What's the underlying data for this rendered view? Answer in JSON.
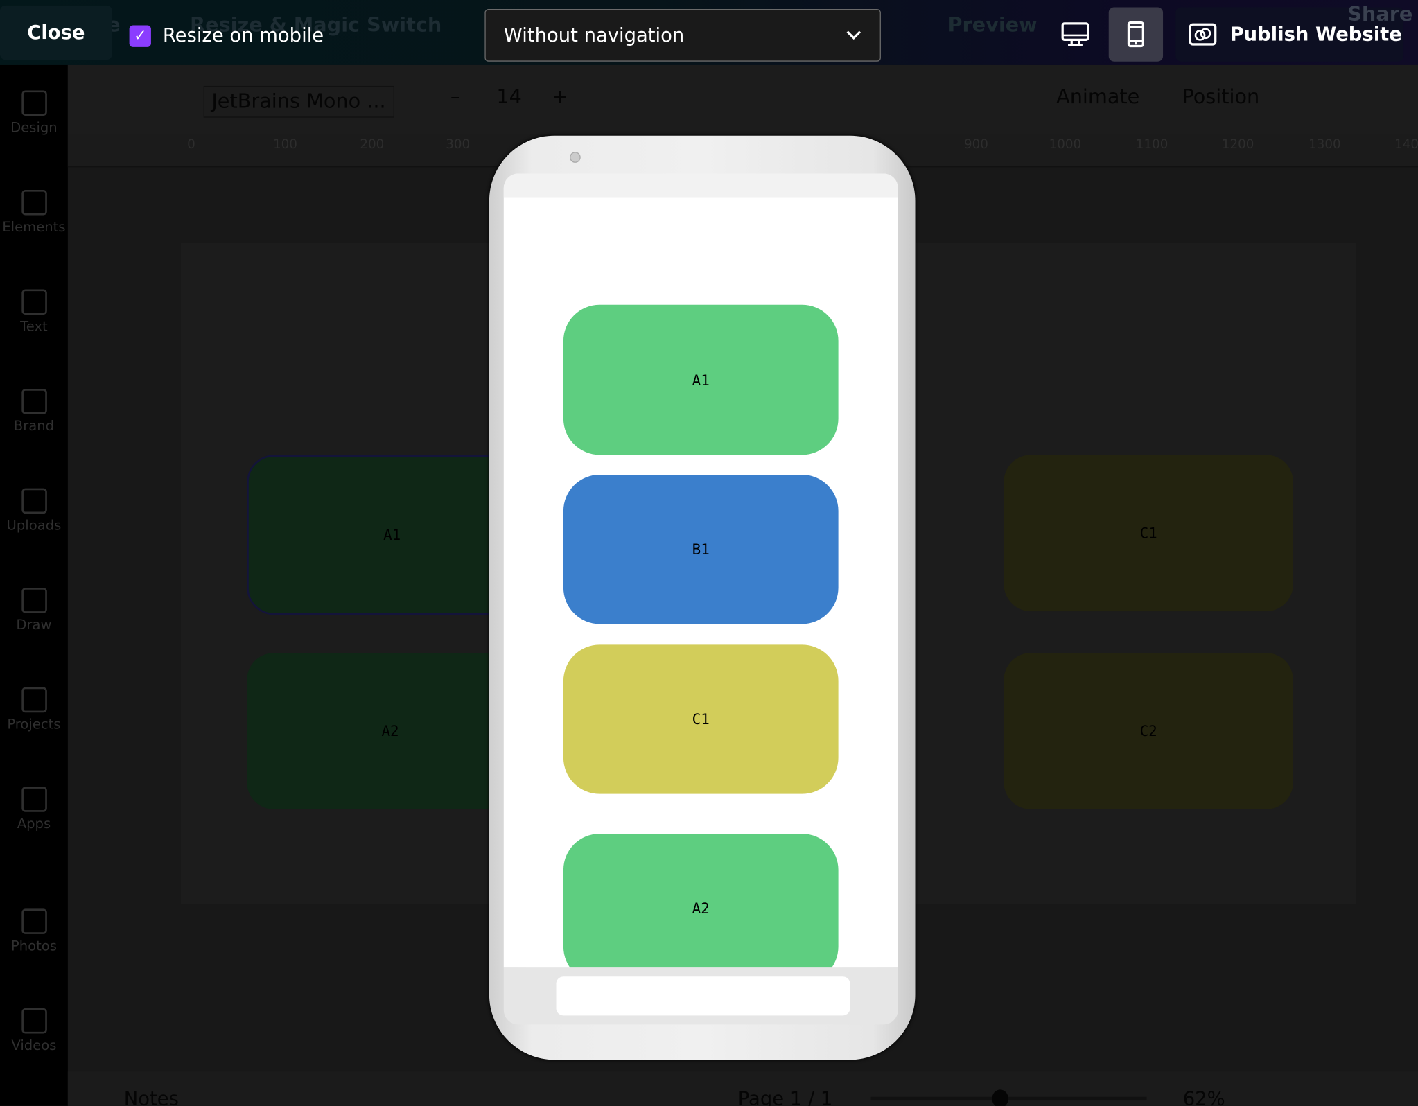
{
  "topbar": {
    "close_label": "Close",
    "resize_on_mobile": {
      "label": "Resize on mobile",
      "checked": true
    },
    "navigation_select": {
      "value": "Without navigation"
    },
    "view_desktop": "desktop-icon",
    "view_mobile": "mobile-icon",
    "view_selected": "mobile",
    "publish_label": "Publish Website",
    "background_items": [
      "File",
      "Resize & Magic Switch",
      "Preview",
      "Publish Website",
      "Share"
    ]
  },
  "sidebar": {
    "items": [
      {
        "label": "Design"
      },
      {
        "label": "Elements"
      },
      {
        "label": "Text"
      },
      {
        "label": "Brand"
      },
      {
        "label": "Uploads"
      },
      {
        "label": "Draw"
      },
      {
        "label": "Projects"
      },
      {
        "label": "Apps"
      },
      {
        "label": "Photos"
      },
      {
        "label": "Videos"
      }
    ]
  },
  "toolbar": {
    "font": "JetBrains Mono ...",
    "font_size": "14",
    "minus": "–",
    "plus": "+",
    "animate": "Animate",
    "position": "Position"
  },
  "ruler": {
    "ticks": [
      "0",
      "100",
      "200",
      "300",
      "900",
      "1000",
      "1100",
      "1200",
      "1300",
      "140"
    ]
  },
  "canvas": {
    "boxes": [
      "A1",
      "C1",
      "A2",
      "C2"
    ]
  },
  "phone": {
    "cards": [
      {
        "label": "A1",
        "color": "#5ece80"
      },
      {
        "label": "B1",
        "color": "#3b7fcc"
      },
      {
        "label": "C1",
        "color": "#d2cd5a"
      },
      {
        "label": "A2",
        "color": "#5ece80"
      }
    ]
  },
  "bottombar": {
    "notes": "Notes",
    "page": "Page 1 / 1",
    "zoom": "62%",
    "zoom_level": 62
  },
  "colors": {
    "accent": "#8b3dff"
  }
}
